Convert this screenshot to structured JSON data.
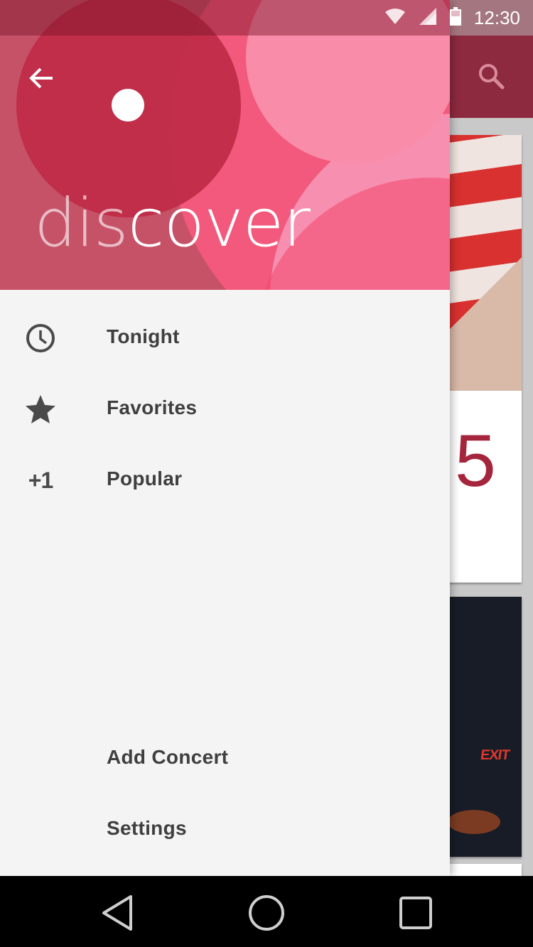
{
  "status_bar": {
    "time": "12:30",
    "icons": [
      "wifi-icon",
      "signal-icon",
      "battery-icon"
    ]
  },
  "background_app": {
    "toolbar_color": "#8e2a40",
    "search_icon": "search-icon",
    "card_number": "5"
  },
  "drawer": {
    "header": {
      "word_part1": "dis",
      "word_part2": "cover",
      "back_icon": "arrow-back-icon"
    },
    "items": [
      {
        "label": "Tonight",
        "icon": "clock-icon"
      },
      {
        "label": "Favorites",
        "icon": "star-icon"
      },
      {
        "label": "Popular",
        "icon_text": "+1"
      }
    ],
    "secondary_items": [
      {
        "label": "Add Concert"
      },
      {
        "label": "Settings"
      }
    ]
  },
  "nav_bar": {
    "buttons": [
      "back-triangle-icon",
      "home-circle-icon",
      "recents-square-icon"
    ]
  },
  "colors": {
    "accent": "#c65268",
    "hot_pink": "#f2597c",
    "dark_red": "#bf2b46",
    "text": "#3f3f3f"
  }
}
